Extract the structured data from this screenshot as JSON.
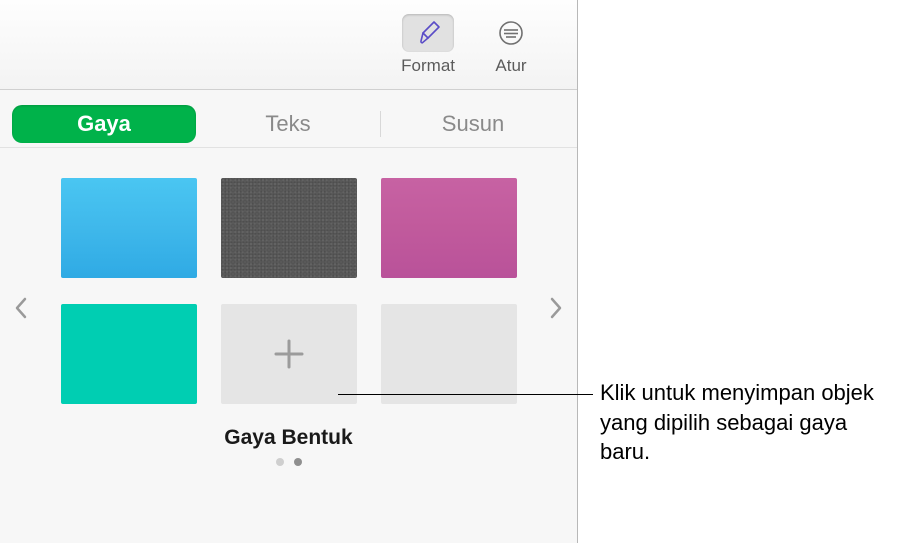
{
  "toolbar": {
    "format": {
      "label": "Format"
    },
    "arrange": {
      "label": "Atur"
    }
  },
  "tabs": {
    "style": "Gaya",
    "text": "Teks",
    "arrange": "Susun"
  },
  "styles": {
    "title": "Gaya Bentuk",
    "swatches": [
      {
        "name": "blue-gradient"
      },
      {
        "name": "gray-texture"
      },
      {
        "name": "pink-gradient"
      },
      {
        "name": "teal-solid"
      },
      {
        "name": "add-new"
      },
      {
        "name": "empty-slot"
      }
    ]
  },
  "callout": {
    "text": "Klik untuk menyimpan objek yang dipilih sebagai gaya baru."
  }
}
